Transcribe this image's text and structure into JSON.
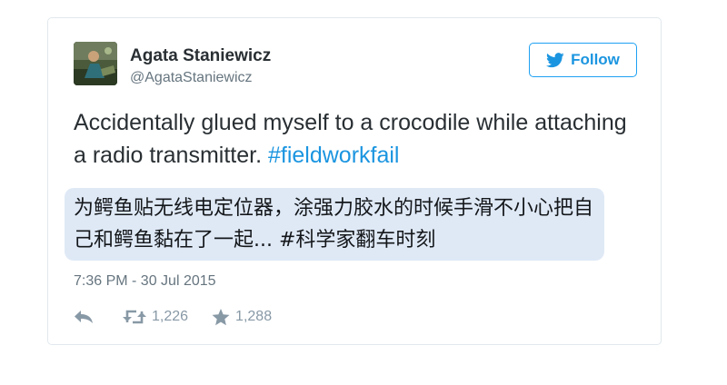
{
  "user": {
    "name": "Agata Staniewicz",
    "handle": "@AgataStaniewicz",
    "avatar_icon": "profile-photo-avatar"
  },
  "follow": {
    "label": "Follow",
    "icon": "twitter-bird-icon",
    "color": "#1b95e0"
  },
  "tweet": {
    "text_plain": "Accidentally glued myself to a crocodile while attaching a radio transmitter.",
    "hashtag": "#fieldworkfail",
    "hashtag_color": "#1b95e0"
  },
  "translation": {
    "text": "为鳄鱼贴无线电定位器，涂强力胶水的时候手滑不小心把自己和鳄鱼黏在了一起... #科学家翻车时刻",
    "background": "#dfe9f6"
  },
  "timestamp": "7:36 PM - 30 Jul 2015",
  "actions": {
    "reply": {
      "icon": "reply-arrow-icon"
    },
    "retweet": {
      "icon": "retweet-icon",
      "count": "1,226"
    },
    "favorite": {
      "icon": "star-icon",
      "count": "1,288"
    }
  }
}
